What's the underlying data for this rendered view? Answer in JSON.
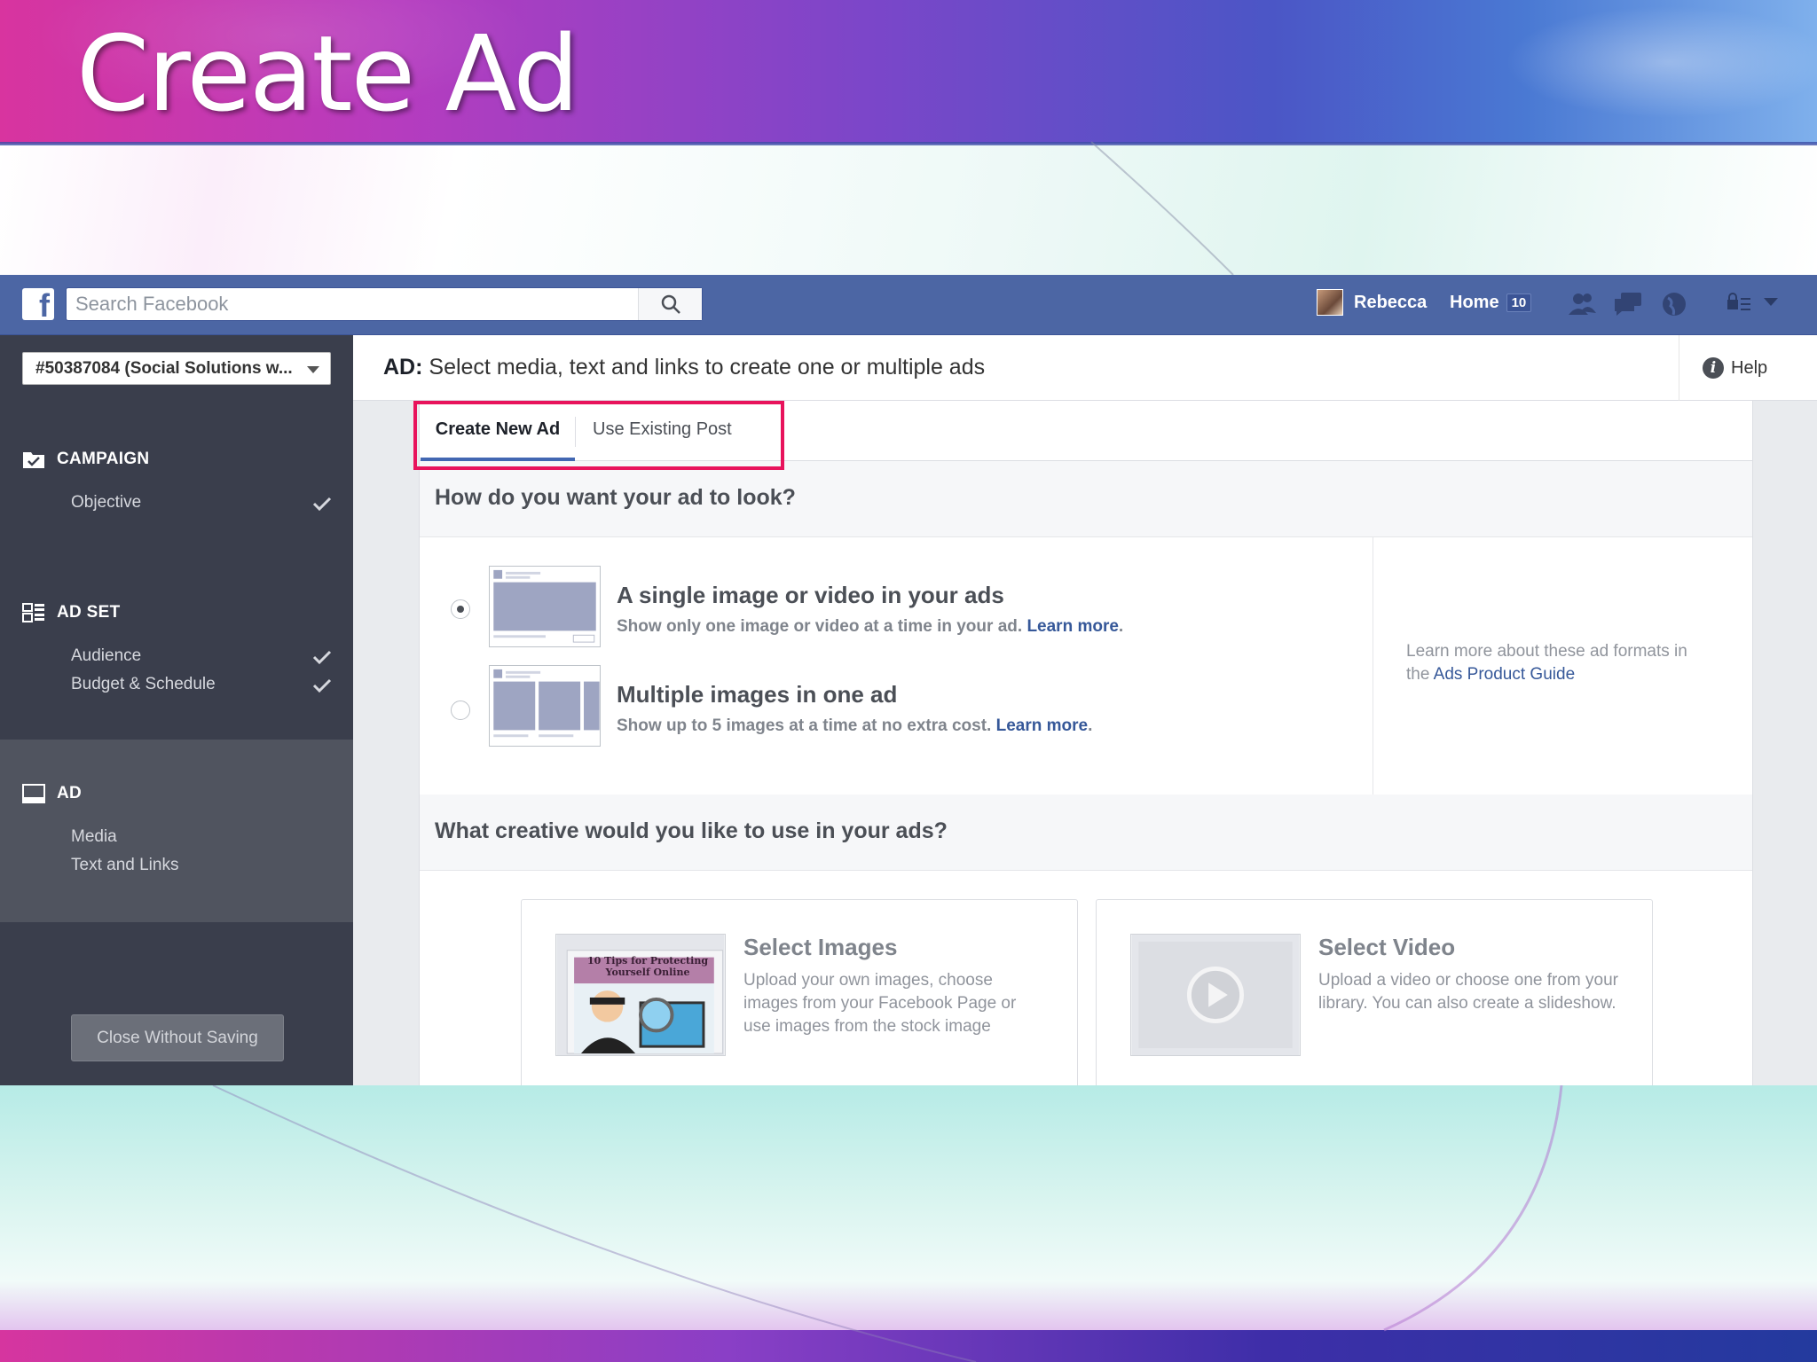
{
  "slide": {
    "title": "Create Ad"
  },
  "facebook": {
    "search_placeholder": "Search Facebook",
    "user_name": "Rebecca",
    "home_label": "Home",
    "home_count": "10"
  },
  "sidebar": {
    "account": "#50387084 (Social Solutions w...",
    "sections": [
      {
        "label": "CAMPAIGN",
        "items": [
          {
            "label": "Objective",
            "done": true
          }
        ]
      },
      {
        "label": "AD SET",
        "items": [
          {
            "label": "Audience",
            "done": true
          },
          {
            "label": "Budget & Schedule",
            "done": true
          }
        ]
      },
      {
        "label": "AD",
        "items": [
          {
            "label": "Media",
            "done": false
          },
          {
            "label": "Text and Links",
            "done": false
          }
        ]
      }
    ],
    "close_button": "Close Without Saving"
  },
  "main": {
    "title_prefix": "AD:",
    "title": "Select media, text and links to create one or multiple ads",
    "help": "Help",
    "tabs": [
      {
        "label": "Create New Ad",
        "active": true
      },
      {
        "label": "Use Existing Post",
        "active": false
      }
    ],
    "format_question": "How do you want your ad to look?",
    "formats": [
      {
        "title": "A single image or video in your ads",
        "desc": "Show only one image or video at a time in your ad.",
        "link": "Learn more",
        "selected": true
      },
      {
        "title": "Multiple images in one ad",
        "desc": "Show up to 5 images at a time at no extra cost.",
        "link": "Learn more",
        "selected": false
      }
    ],
    "side_note_text": "Learn more about these ad formats in the",
    "side_note_link": "Ads Product Guide",
    "creative_question": "What creative would you like to use in your ads?",
    "creatives": [
      {
        "title": "Select Images",
        "desc": "Upload your own images, choose images from your Facebook Page or use images from the stock image",
        "thumb_caption": "10 Tips for Protecting Yourself Online"
      },
      {
        "title": "Select Video",
        "desc": "Upload a video or choose one from your library. You can also create a slideshow."
      }
    ]
  },
  "colors": {
    "facebook_blue": "#4c66a4",
    "sidebar_bg": "#3a3e4c",
    "highlight_box": "#e8135c",
    "link": "#365899"
  }
}
